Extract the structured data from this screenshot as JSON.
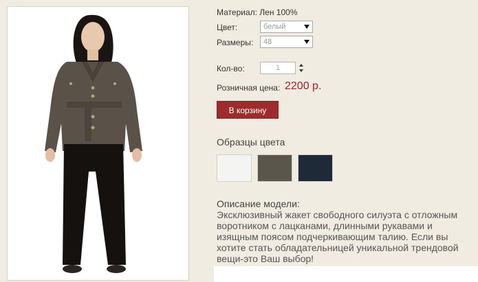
{
  "product": {
    "material_line": "Материал: Лен 100%",
    "color_label": "Цвет:",
    "color_value": "белый",
    "size_label": "Размеры:",
    "size_value": "48",
    "qty_label": "Кол-во:",
    "qty_value": "1",
    "price_label": "Розничная цена:",
    "price_value": "2200 р.",
    "cart_button": "В корзину"
  },
  "swatches": {
    "title": "Образцы цвета",
    "colors": [
      "#f4f4f2",
      "#5b564c",
      "#1f2a38"
    ]
  },
  "description": {
    "title": "Описание модели:",
    "text": "Эксклюзивный жакет свободного силуэта с отложным воротником с лацканами, длинными рукавами и изящным поясом подчеркивающим талию. Если вы хотите стать обладательницей уникальной трендовой вещи-это Ваш выбор!"
  }
}
